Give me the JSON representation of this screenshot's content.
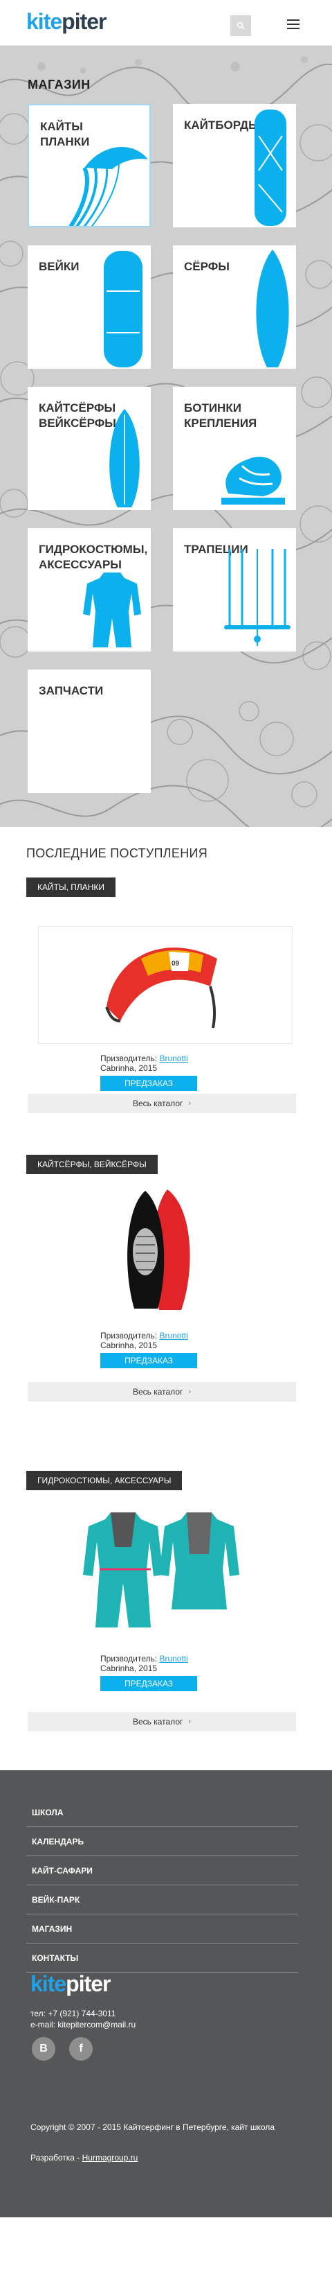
{
  "header": {
    "logo_kite": "kite",
    "logo_piter": "piter",
    "search_icon": "search-icon",
    "menu_icon": "hamburger-icon"
  },
  "shop": {
    "title": "МАГАЗИН",
    "tiles": [
      {
        "label": "КАЙТЫ ПЛАНКИ",
        "icon": "kite-icon"
      },
      {
        "label": "КАЙТБОРДЫ",
        "icon": "kiteboard-icon"
      },
      {
        "label": "ВЕЙКИ",
        "icon": "wakeboard-icon"
      },
      {
        "label": "СЁРФЫ",
        "icon": "surfboard-icon"
      },
      {
        "label": "КАЙТСЁРФЫ ВЕЙКСЁРФЫ",
        "icon": "kitesurf-icon"
      },
      {
        "label": "БОТИНКИ КРЕПЛЕНИЯ",
        "icon": "binding-icon"
      },
      {
        "label": "ГИДРОКОСТЮМЫ, АКСЕССУАРЫ",
        "icon": "wetsuit-icon"
      },
      {
        "label": "ТРАПЕЦИИ",
        "icon": "harness-bar-icon"
      },
      {
        "label": "ЗАПЧАСТИ",
        "icon": ""
      }
    ]
  },
  "latest": {
    "title": "ПОСЛЕДНИЕ ПОСТУПЛЕНИЯ",
    "blocks": [
      {
        "category": "КАЙТЫ, ПЛАНКИ",
        "maker_label": "Призводитель:",
        "maker": "Brunotti",
        "year": "Cabrinha, 2015",
        "button": "ПРЕДЗАКАЗ",
        "catalog": "Весь каталог"
      },
      {
        "category": "КАЙТСЁРФЫ, ВЕЙКСЁРФЫ",
        "maker_label": "Призводитель:",
        "maker": "Brunotti",
        "year": "Cabrinha, 2015",
        "button": "ПРЕДЗАКАЗ",
        "catalog": "Весь каталог"
      },
      {
        "category": "ГИДРОКОСТЮМЫ, АКСЕССУАРЫ",
        "maker_label": "Призводитель:",
        "maker": "Brunotti",
        "year": "Cabrinha, 2015",
        "button": "ПРЕДЗАКАЗ",
        "catalog": "Весь каталог"
      }
    ]
  },
  "footer": {
    "nav": [
      "ШКОЛА",
      "КАЛЕНДАРЬ",
      "КАЙТ-САФАРИ",
      "ВЕЙК-ПАРК",
      "МАГАЗИН",
      "КОНТАКТЫ"
    ],
    "logo_kite": "kite",
    "logo_piter": "piter",
    "phone": "тел: +7 (921) 744-3011",
    "email": "e-mail: kitepitercom@mail.ru",
    "social": [
      {
        "label": "В",
        "icon": "vk-icon"
      },
      {
        "label": "f",
        "icon": "facebook-icon"
      }
    ],
    "copyright": "Copyright © 2007 - 2015 Кайтсерфинг в Петербурге, кайт школа",
    "dev_label": "Разработка -",
    "dev_link": "Hurmagroup.ru"
  },
  "colors": {
    "accent": "#0bb0ec",
    "logo_blue": "#1fa3e6",
    "footer_bg": "#555657",
    "tag_bg": "#333333"
  }
}
